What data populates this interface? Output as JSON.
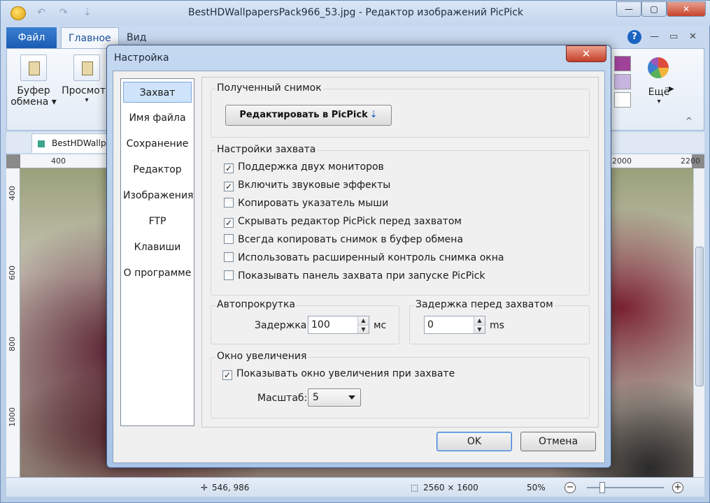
{
  "window": {
    "title": "BestHDWallpapersPack966_53.jpg - Редактор изображений PicPick",
    "ctrl_min": "—",
    "ctrl_max": "▢",
    "ctrl_close": "✕"
  },
  "quick_access": {
    "undo": "↶",
    "redo": "↷",
    "menu": "⇣"
  },
  "ribbon_tabs": {
    "file": "Файл",
    "home": "Главное",
    "view": "Вид",
    "help": "?"
  },
  "ribbon": {
    "clipboard_label_line1": "Буфер",
    "clipboard_label_line2": "обмена ▾",
    "view_label": "Просмотр",
    "view_arrow": "▾",
    "more_label": "Ещё",
    "more_arrow": "▾",
    "collapse": "^"
  },
  "colors": {
    "swatch_purple": "#a0429a",
    "swatch_lavender": "#c8b4e0",
    "swatch_white": "#ffffff"
  },
  "doc_tab": {
    "label": "BestHDWallpa"
  },
  "ruler": {
    "top_ticks": [
      "400",
      "2000",
      "2200"
    ],
    "left_ticks": [
      "400",
      "600",
      "800",
      "1000"
    ]
  },
  "statusbar": {
    "cursor_pos": "546, 986",
    "image_size": "2560 × 1600",
    "zoom": "50%",
    "zoom_out": "−",
    "zoom_in": "+"
  },
  "dialog": {
    "title": "Настройка",
    "close": "✕",
    "nav": [
      "Захват",
      "Имя файла",
      "Сохранение",
      "Редактор",
      "Изображения",
      "FTP",
      "Клавиши",
      "О программе"
    ],
    "captured": {
      "title": "Полученный снимок",
      "button": "Редактировать в PicPick",
      "button_arrow": "⇣"
    },
    "capture_settings": {
      "title": "Настройки захвата",
      "options": [
        {
          "label": "Поддержка двух мониторов",
          "checked": "✓"
        },
        {
          "label": "Включить звуковые эффекты",
          "checked": "✓"
        },
        {
          "label": "Копировать указатель мыши",
          "checked": ""
        },
        {
          "label": "Скрывать редактор PicPick перед захватом",
          "checked": "✓"
        },
        {
          "label": "Всегда копировать снимок в буфер обмена",
          "checked": ""
        },
        {
          "label": "Использовать расширенный контроль снимка окна",
          "checked": ""
        },
        {
          "label": "Показывать панель захвата при запуске PicPick",
          "checked": ""
        }
      ]
    },
    "autoscroll": {
      "title": "Автопрокрутка",
      "delay_label": "Задержка:",
      "delay_value": "100",
      "unit": "мс"
    },
    "capture_delay": {
      "title": "Задержка перед захватом",
      "value": "0",
      "unit": "ms"
    },
    "magnifier": {
      "title": "Окно увеличения",
      "show_label": "Показывать окно увеличения при захвате",
      "show_checked": "✓",
      "scale_label": "Масштаб:",
      "scale_value": "5"
    },
    "ok": "OK",
    "cancel": "Отмена"
  }
}
